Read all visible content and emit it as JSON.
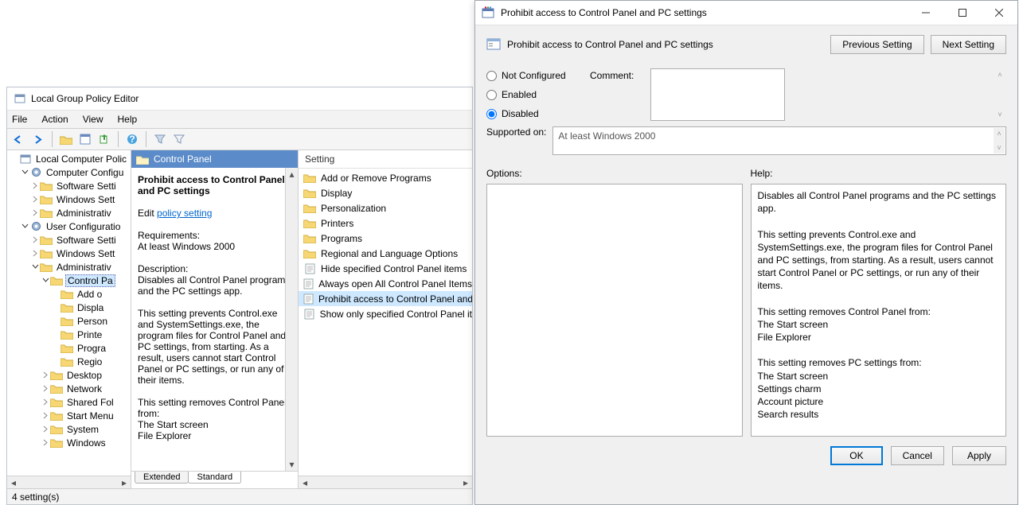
{
  "gpe": {
    "title": "Local Group Policy Editor",
    "menu": [
      "File",
      "Action",
      "View",
      "Help"
    ],
    "toolbar_icons": [
      "arrow-left-icon",
      "arrow-right-icon",
      "folder-up-icon",
      "properties-icon",
      "export-icon",
      "help-icon",
      "filter-off-icon",
      "filter-options-icon"
    ],
    "status": "4 setting(s)",
    "tree": [
      {
        "depth": 0,
        "caret": "",
        "icon": "policy",
        "label": "Local Computer Polic"
      },
      {
        "depth": 1,
        "caret": "v",
        "icon": "gear",
        "label": "Computer Configu"
      },
      {
        "depth": 2,
        "caret": ">",
        "icon": "folder",
        "label": "Software Setti"
      },
      {
        "depth": 2,
        "caret": ">",
        "icon": "folder",
        "label": "Windows Sett"
      },
      {
        "depth": 2,
        "caret": ">",
        "icon": "folder",
        "label": "Administrativ"
      },
      {
        "depth": 1,
        "caret": "v",
        "icon": "gear",
        "label": "User Configuratio"
      },
      {
        "depth": 2,
        "caret": ">",
        "icon": "folder",
        "label": "Software Setti"
      },
      {
        "depth": 2,
        "caret": ">",
        "icon": "folder",
        "label": "Windows Sett"
      },
      {
        "depth": 2,
        "caret": "v",
        "icon": "folder",
        "label": "Administrativ"
      },
      {
        "depth": 3,
        "caret": "v",
        "icon": "folder",
        "label": "Control Pa",
        "selected": true
      },
      {
        "depth": 4,
        "caret": "",
        "icon": "folder",
        "label": "Add o"
      },
      {
        "depth": 4,
        "caret": "",
        "icon": "folder",
        "label": "Displa"
      },
      {
        "depth": 4,
        "caret": "",
        "icon": "folder",
        "label": "Person"
      },
      {
        "depth": 4,
        "caret": "",
        "icon": "folder",
        "label": "Printe"
      },
      {
        "depth": 4,
        "caret": "",
        "icon": "folder",
        "label": "Progra"
      },
      {
        "depth": 4,
        "caret": "",
        "icon": "folder",
        "label": "Regio"
      },
      {
        "depth": 3,
        "caret": ">",
        "icon": "folder",
        "label": "Desktop"
      },
      {
        "depth": 3,
        "caret": ">",
        "icon": "folder",
        "label": "Network"
      },
      {
        "depth": 3,
        "caret": ">",
        "icon": "folder",
        "label": "Shared Fol"
      },
      {
        "depth": 3,
        "caret": ">",
        "icon": "folder",
        "label": "Start Menu"
      },
      {
        "depth": 3,
        "caret": ">",
        "icon": "folder",
        "label": "System"
      },
      {
        "depth": 3,
        "caret": ">",
        "icon": "folder",
        "label": "Windows"
      }
    ],
    "mid": {
      "header": "Control Panel",
      "title": "Prohibit access to Control Panel and PC settings",
      "edit_prefix": "Edit ",
      "edit_link": "policy setting ",
      "req_label": "Requirements:",
      "req_value": "At least Windows 2000",
      "desc_label": "Description:",
      "desc_body": "Disables all Control Panel programs and the PC settings app.\n\nThis setting prevents Control.exe and SystemSettings.exe, the program files for Control Panel and PC settings, from starting. As a result, users cannot start Control Panel or PC settings, or run any of their items.\n\nThis setting removes Control Panel from:\nThe Start screen\nFile Explorer"
    },
    "list": {
      "colhdr": "Setting",
      "items": [
        {
          "icon": "folder",
          "label": "Add or Remove Programs"
        },
        {
          "icon": "folder",
          "label": "Display"
        },
        {
          "icon": "folder",
          "label": "Personalization"
        },
        {
          "icon": "folder",
          "label": "Printers"
        },
        {
          "icon": "folder",
          "label": "Programs"
        },
        {
          "icon": "folder",
          "label": "Regional and Language Options"
        },
        {
          "icon": "doc",
          "label": "Hide specified Control Panel items"
        },
        {
          "icon": "doc",
          "label": "Always open All Control Panel Items"
        },
        {
          "icon": "doc",
          "label": "Prohibit access to Control Panel and",
          "selected": true
        },
        {
          "icon": "doc",
          "label": "Show only specified Control Panel it"
        }
      ]
    },
    "tabs": [
      "Extended",
      "Standard"
    ],
    "active_tab": 1
  },
  "dlg": {
    "title": "Prohibit access to Control Panel and PC settings",
    "setting_title": "Prohibit access to Control Panel and PC settings",
    "nav": {
      "prev": "Previous Setting",
      "next": "Next Setting"
    },
    "radios": {
      "nc": "Not Configured",
      "en": "Enabled",
      "dis": "Disabled"
    },
    "selected_radio": "dis",
    "comment_label": "Comment:",
    "supported_label": "Supported on:",
    "supported_value": "At least Windows 2000",
    "options_label": "Options:",
    "help_label": "Help:",
    "help_text": "Disables all Control Panel programs and the PC settings app.\n\nThis setting prevents Control.exe and SystemSettings.exe, the program files for Control Panel and PC settings, from starting. As a result, users cannot start Control Panel or PC settings, or run any of their items.\n\nThis setting removes Control Panel from:\nThe Start screen\nFile Explorer\n\nThis setting removes PC settings from:\nThe Start screen\nSettings charm\nAccount picture\nSearch results\n\nIf users try to select a Control Panel item from the Properties item on a context menu, a message appears explaining that a setting prevents the action.",
    "buttons": {
      "ok": "OK",
      "cancel": "Cancel",
      "apply": "Apply"
    }
  }
}
